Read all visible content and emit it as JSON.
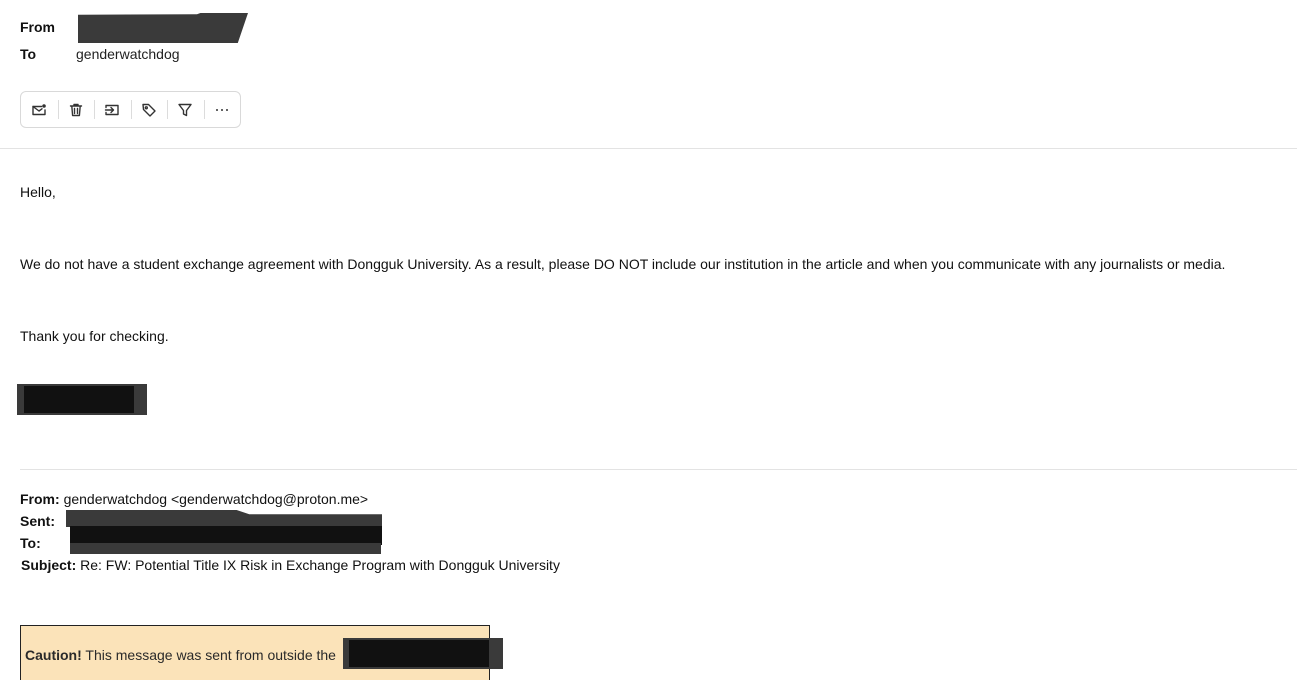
{
  "header": {
    "from_label": "From",
    "to_label": "To",
    "to_value": "genderwatchdog"
  },
  "toolbar": {
    "buttons": [
      {
        "name": "mark-unread",
        "icon": "envelope-dot-icon"
      },
      {
        "name": "delete",
        "icon": "trash-icon"
      },
      {
        "name": "move",
        "icon": "move-to-folder-icon"
      },
      {
        "name": "label",
        "icon": "tag-icon"
      },
      {
        "name": "filter",
        "icon": "filter-icon"
      },
      {
        "name": "more",
        "icon": "more-horizontal-icon"
      }
    ]
  },
  "message": {
    "greeting": "Hello,",
    "paragraph": "We do not have a student exchange agreement with Dongguk University.  As a result, please DO NOT include our institution in the article and when you communicate with any journalists or media.",
    "closing": "Thank you for checking."
  },
  "quoted": {
    "from_label": "From:",
    "from_value": "genderwatchdog <genderwatchdog@proton.me>",
    "sent_label": "Sent:",
    "to_label": "To:",
    "subject_label": "Subject:",
    "subject_value": "Re: FW: Potential Title IX Risk in Exchange Program with Dongguk University"
  },
  "caution": {
    "bold": "Caution!",
    "text": "This message was sent from outside the",
    "background": "#fbe3b9"
  }
}
